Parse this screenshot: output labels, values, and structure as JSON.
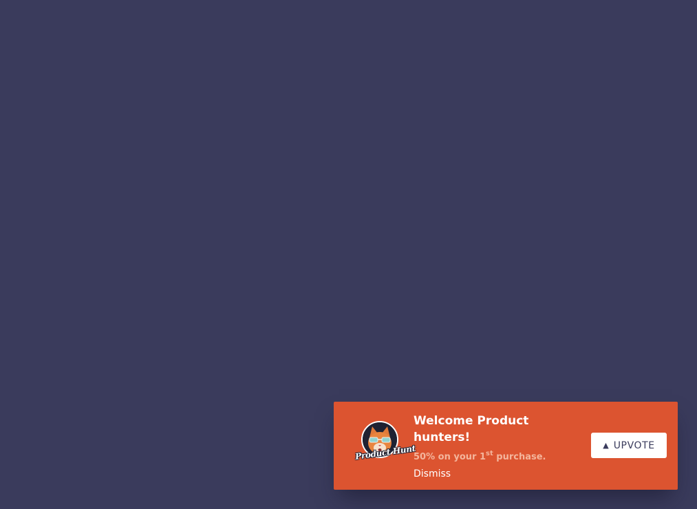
{
  "toast": {
    "background": "#dc5430",
    "logo": {
      "icon": "product-hunt-cat-logo",
      "script_text": "Product Hunt"
    },
    "title": "Welcome Product hunters!",
    "offer": {
      "prefix": "50% on your 1",
      "superscript": "st",
      "suffix": " purchase."
    },
    "dismiss_label": "Dismiss",
    "upvote": {
      "icon": "triangle-up-icon",
      "label": "UPVOTE"
    }
  },
  "page": {
    "background": "#3a3b5c"
  }
}
